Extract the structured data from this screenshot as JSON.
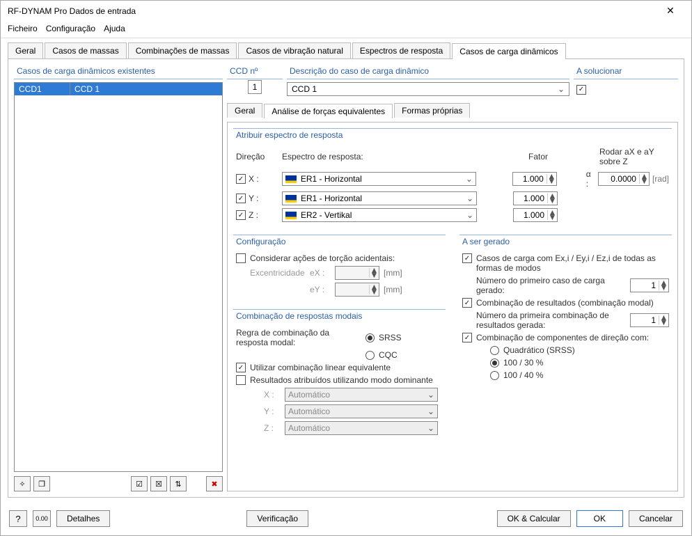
{
  "window": {
    "title": "RF-DYNAM Pro Dados de entrada"
  },
  "menu": {
    "file": "Ficheiro",
    "config": "Configuração",
    "help": "Ajuda"
  },
  "tabs": {
    "general": "Geral",
    "mass_cases": "Casos de massas",
    "mass_combos": "Combinações de massas",
    "natural_vib": "Casos de vibração natural",
    "response_spectra": "Espectros de resposta",
    "dynamic_lc": "Casos de carga dinâmicos"
  },
  "leftpanel": {
    "title": "Casos de carga dinâmicos existentes",
    "rows": [
      {
        "no": "CCD1",
        "desc": "CCD 1"
      }
    ]
  },
  "toprow": {
    "ccd_no_label": "CCD nº",
    "ccd_no_value": "1",
    "desc_label": "Descrição do caso de carga dinâmico",
    "desc_value": "CCD 1",
    "solve_label": "A solucionar"
  },
  "subtabs": {
    "general": "Geral",
    "equiv": "Análise de forças equivalentes",
    "modes": "Formas próprias"
  },
  "assign": {
    "title": "Atribuir espectro de resposta",
    "dir_label": "Direção",
    "spectrum_label": "Espectro de resposta:",
    "factor_label": "Fator",
    "rotate_label1": "Rodar aX e aY",
    "rotate_label2": "sobre Z",
    "alpha_label": "α :",
    "alpha_value": "0.0000",
    "alpha_unit": "[rad]",
    "x_label": "X :",
    "y_label": "Y :",
    "z_label": "Z :",
    "opt_h": "ER1 - Horizontal",
    "opt_v": "ER2 - Vertikal",
    "factor_x": "1.000",
    "factor_y": "1.000",
    "factor_z": "1.000"
  },
  "config": {
    "title": "Configuração",
    "torsion": "Considerar ações de torção acidentais:",
    "ecc_label": "Excentricidade",
    "ex_label": "eX :",
    "ey_label": "eY :",
    "unit": "[mm]"
  },
  "modal": {
    "title": "Combinação de respostas modais",
    "rule": "Regra de combinação da resposta modal:",
    "srss": "SRSS",
    "cqc": "CQC",
    "linear": "Utilizar combinação linear equivalente",
    "dominant": "Resultados atribuídos utilizando modo dominante",
    "x_label": "X :",
    "y_label": "Y :",
    "z_label": "Z :",
    "auto": "Automático"
  },
  "togen": {
    "title": "A ser gerado",
    "lc": "Casos de carga com Ex,i / Ey,i / Ez,i de todas as formas de modos",
    "first_lc": "Número do primeiro caso de carga gerado:",
    "first_lc_val": "1",
    "rc": "Combinação de resultados (combinação modal)",
    "first_rc": "Número da primeira combinação de resultados gerada:",
    "first_rc_val": "1",
    "dir": "Combinação de componentes de direção com:",
    "quad": "Quadrático (SRSS)",
    "p10030": "100 / 30 %",
    "p10040": "100 / 40 %"
  },
  "footer": {
    "details": "Detalhes",
    "verify": "Verificação",
    "okcalc": "OK & Calcular",
    "ok": "OK",
    "cancel": "Cancelar"
  }
}
